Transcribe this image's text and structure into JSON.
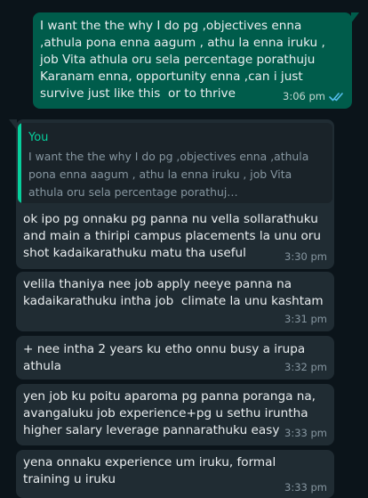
{
  "colors": {
    "background": "#0b141a",
    "outgoing_bubble": "#005c4b",
    "incoming_bubble": "#202c33",
    "quote_accent": "#06cf9c",
    "read_ticks": "#53bdeb"
  },
  "messages": [
    {
      "direction": "outgoing",
      "text": "I want the the why I do pg ,objectives enna ,athula pona enna aagum , athu la enna iruku , job Vita athula oru sela percentage porathuju Karanam enna, opportunity enna ,can i just survive just like this  or to thrive",
      "time": "3:06 pm",
      "status_icon": "double-check-read-icon"
    },
    {
      "direction": "incoming",
      "quote": {
        "author": "You",
        "text": "I want the the why I do pg ,objectives enna ,athula pona enna aagum , athu la enna iruku , job Vita athula oru sela percentage porathuj…"
      },
      "text": "ok ipo pg onnaku pg panna nu vella sollarathuku and main a thiripi campus placements la unu oru shot kadaikarathuku matu tha useful",
      "time": "3:30 pm"
    },
    {
      "direction": "incoming",
      "text": "velila thaniya nee job apply neeye panna na kadaikarathuku intha job  climate la unu kashtam",
      "time": "3:31 pm"
    },
    {
      "direction": "incoming",
      "text": "+ nee intha 2 years ku etho onnu busy a irupa athula",
      "time": "3:32 pm"
    },
    {
      "direction": "incoming",
      "text": "yen job ku poitu aparoma pg panna poranga na, avangaluku job experience+pg u sethu iruntha higher salary leverage pannarathuku easy",
      "time": "3:33 pm"
    },
    {
      "direction": "incoming",
      "text": "yena onnaku experience um iruku, formal training u iruku",
      "time": "3:33 pm"
    }
  ]
}
